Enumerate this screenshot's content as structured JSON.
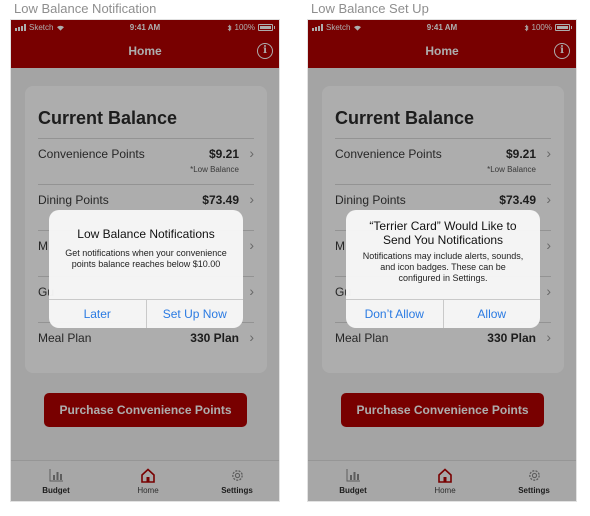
{
  "screens": [
    {
      "board_title": "Low Balance Notification",
      "status": {
        "carrier": "Sketch",
        "time": "9:41 AM",
        "battery": "100%"
      },
      "nav": {
        "title": "Home"
      },
      "card": {
        "title": "Current Balance",
        "rows": [
          {
            "label": "Convenience Points",
            "value": "$9.21",
            "note": "*Low Balance"
          },
          {
            "label": "Dining Points",
            "value": "$73.49",
            "note": ""
          },
          {
            "label": "M",
            "value": "",
            "note": ""
          },
          {
            "label": "Gu",
            "value": "",
            "note": ""
          },
          {
            "label": "Meal Plan",
            "value": "330 Plan",
            "note": ""
          }
        ]
      },
      "purchase_button": "Purchase Convenience Points",
      "tabs": [
        {
          "label": "Budget",
          "icon": "chart-icon"
        },
        {
          "label": "Home",
          "icon": "home-icon"
        },
        {
          "label": "Settings",
          "icon": "gear-icon"
        }
      ],
      "alert": {
        "title": "Low Balance Notifications",
        "message": "Get notifications when your convenience points balance reaches below $10.00",
        "buttons": [
          "Later",
          "Set Up Now"
        ]
      }
    },
    {
      "board_title": "Low Balance Set Up",
      "status": {
        "carrier": "Sketch",
        "time": "9:41 AM",
        "battery": "100%"
      },
      "nav": {
        "title": "Home"
      },
      "card": {
        "title": "Current Balance",
        "rows": [
          {
            "label": "Convenience Points",
            "value": "$9.21",
            "note": "*Low Balance"
          },
          {
            "label": "Dining Points",
            "value": "$73.49",
            "note": ""
          },
          {
            "label": "M",
            "value": "",
            "note": ""
          },
          {
            "label": "Gu",
            "value": "",
            "note": ""
          },
          {
            "label": "Meal Plan",
            "value": "330 Plan",
            "note": ""
          }
        ]
      },
      "purchase_button": "Purchase Convenience Points",
      "tabs": [
        {
          "label": "Budget",
          "icon": "chart-icon"
        },
        {
          "label": "Home",
          "icon": "home-icon"
        },
        {
          "label": "Settings",
          "icon": "gear-icon"
        }
      ],
      "alert": {
        "title": "“Terrier Card” Would Like to Send You Notifications",
        "message": "Notifications may include alerts, sounds, and icon badges. These can be configured in Settings.",
        "buttons": [
          "Don’t Allow",
          "Allow"
        ]
      }
    }
  ],
  "colors": {
    "brand": "#b20000",
    "accent": "#2a7ae2",
    "background": "#f2f2f2"
  }
}
